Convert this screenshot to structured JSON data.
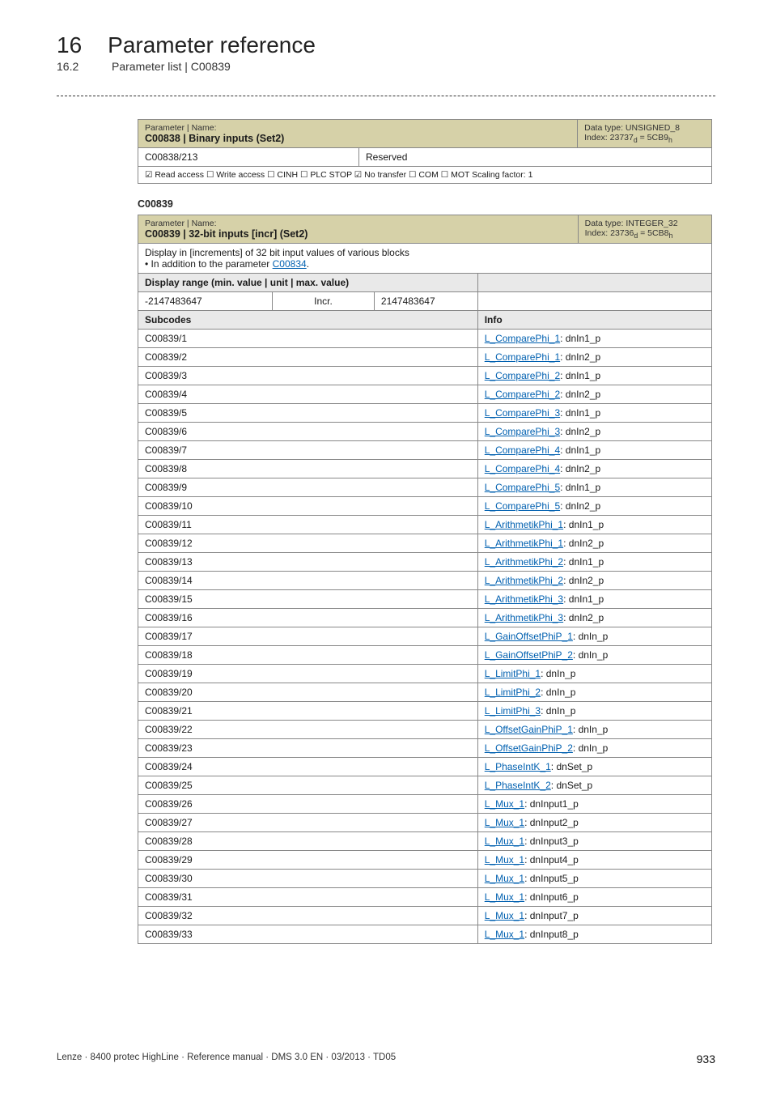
{
  "chapter": {
    "num": "16",
    "title": "Parameter reference"
  },
  "subchapter": {
    "num": "16.2",
    "title": "Parameter list | C00839"
  },
  "table1": {
    "pn_label": "Parameter | Name:",
    "pn_value": "C00838 | Binary inputs (Set2)",
    "meta_line1": "Data type: UNSIGNED_8",
    "meta_line2_html": "Index: 23737<sub>d</sub> = 5CB9<sub>h</sub>",
    "row_sub": {
      "code": "C00838/213",
      "val": "Reserved"
    },
    "flags": "☑ Read access  ☐ Write access  ☐ CINH  ☐ PLC STOP  ☑ No transfer  ☐ COM  ☐ MOT    Scaling factor: 1"
  },
  "section2_heading": "C00839",
  "table2": {
    "pn_label": "Parameter | Name:",
    "pn_value": "C00839 | 32-bit inputs [incr] (Set2)",
    "meta_line1": "Data type: INTEGER_32",
    "meta_line2_html": "Index: 23736<sub>d</sub> = 5CB8<sub>h</sub>",
    "desc_line1": "Display in [increments] of 32 bit input values of various blocks",
    "desc_line2_pre": " • In addition to the parameter ",
    "desc_line2_link": "C00834",
    "desc_line2_post": ".",
    "range_label": "Display range (min. value | unit | max. value)",
    "range_min": "-2147483647",
    "range_unit": "Incr.",
    "range_max": "2147483647",
    "subcodes_label": "Subcodes",
    "info_label": "Info",
    "rows": [
      {
        "code": "C00839/1",
        "link": "L_ComparePhi_1",
        "suffix": ": dnIn1_p"
      },
      {
        "code": "C00839/2",
        "link": "L_ComparePhi_1",
        "suffix": ": dnIn2_p"
      },
      {
        "code": "C00839/3",
        "link": "L_ComparePhi_2",
        "suffix": ": dnIn1_p"
      },
      {
        "code": "C00839/4",
        "link": "L_ComparePhi_2",
        "suffix": ": dnIn2_p"
      },
      {
        "code": "C00839/5",
        "link": "L_ComparePhi_3",
        "suffix": ": dnIn1_p"
      },
      {
        "code": "C00839/6",
        "link": "L_ComparePhi_3",
        "suffix": ": dnIn2_p"
      },
      {
        "code": "C00839/7",
        "link": "L_ComparePhi_4",
        "suffix": ": dnIn1_p"
      },
      {
        "code": "C00839/8",
        "link": "L_ComparePhi_4",
        "suffix": ": dnIn2_p"
      },
      {
        "code": "C00839/9",
        "link": "L_ComparePhi_5",
        "suffix": ": dnIn1_p"
      },
      {
        "code": "C00839/10",
        "link": "L_ComparePhi_5",
        "suffix": ": dnIn2_p"
      },
      {
        "code": "C00839/11",
        "link": "L_ArithmetikPhi_1",
        "suffix": ": dnIn1_p"
      },
      {
        "code": "C00839/12",
        "link": "L_ArithmetikPhi_1",
        "suffix": ": dnIn2_p"
      },
      {
        "code": "C00839/13",
        "link": "L_ArithmetikPhi_2",
        "suffix": ": dnIn1_p"
      },
      {
        "code": "C00839/14",
        "link": "L_ArithmetikPhi_2",
        "suffix": ": dnIn2_p"
      },
      {
        "code": "C00839/15",
        "link": "L_ArithmetikPhi_3",
        "suffix": ": dnIn1_p"
      },
      {
        "code": "C00839/16",
        "link": "L_ArithmetikPhi_3",
        "suffix": ": dnIn2_p"
      },
      {
        "code": "C00839/17",
        "link": "L_GainOffsetPhiP_1",
        "suffix": ": dnIn_p"
      },
      {
        "code": "C00839/18",
        "link": "L_GainOffsetPhiP_2",
        "suffix": ": dnIn_p"
      },
      {
        "code": "C00839/19",
        "link": "L_LimitPhi_1",
        "suffix": ": dnIn_p"
      },
      {
        "code": "C00839/20",
        "link": "L_LimitPhi_2",
        "suffix": ": dnIn_p"
      },
      {
        "code": "C00839/21",
        "link": "L_LimitPhi_3",
        "suffix": ": dnIn_p"
      },
      {
        "code": "C00839/22",
        "link": "L_OffsetGainPhiP_1",
        "suffix": ": dnIn_p"
      },
      {
        "code": "C00839/23",
        "link": "L_OffsetGainPhiP_2",
        "suffix": ": dnIn_p"
      },
      {
        "code": "C00839/24",
        "link": "L_PhaseIntK_1",
        "suffix": ": dnSet_p"
      },
      {
        "code": "C00839/25",
        "link": "L_PhaseIntK_2",
        "suffix": ": dnSet_p"
      },
      {
        "code": "C00839/26",
        "link": "L_Mux_1",
        "suffix": ": dnInput1_p"
      },
      {
        "code": "C00839/27",
        "link": "L_Mux_1",
        "suffix": ": dnInput2_p"
      },
      {
        "code": "C00839/28",
        "link": "L_Mux_1",
        "suffix": ": dnInput3_p"
      },
      {
        "code": "C00839/29",
        "link": "L_Mux_1",
        "suffix": ": dnInput4_p"
      },
      {
        "code": "C00839/30",
        "link": "L_Mux_1",
        "suffix": ": dnInput5_p"
      },
      {
        "code": "C00839/31",
        "link": "L_Mux_1",
        "suffix": ": dnInput6_p"
      },
      {
        "code": "C00839/32",
        "link": "L_Mux_1",
        "suffix": ": dnInput7_p"
      },
      {
        "code": "C00839/33",
        "link": "L_Mux_1",
        "suffix": ": dnInput8_p"
      }
    ]
  },
  "footer": {
    "left": "Lenze · 8400 protec HighLine · Reference manual · DMS 3.0 EN · 03/2013 · TD05",
    "page": "933"
  }
}
